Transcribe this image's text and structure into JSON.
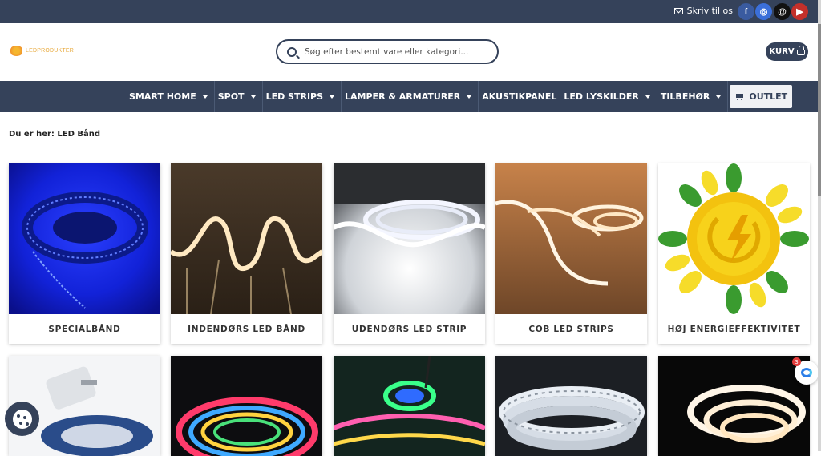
{
  "topbar": {
    "contact_label": "Skriv til os",
    "social": [
      {
        "icon": "facebook-icon",
        "glyph": "f"
      },
      {
        "icon": "instagram-icon",
        "glyph": "◎"
      },
      {
        "icon": "threads-icon",
        "glyph": "@"
      },
      {
        "icon": "youtube-icon",
        "glyph": "▶"
      }
    ]
  },
  "header": {
    "logo_text": "LEDPRODUKTER",
    "search_placeholder": "Søg efter bestemt vare eller kategori...",
    "cart_label": "KURV"
  },
  "nav": {
    "items": [
      {
        "label": "SMART HOME",
        "has_dropdown": true
      },
      {
        "label": "SPOT",
        "has_dropdown": true
      },
      {
        "label": "LED STRIPS",
        "has_dropdown": true
      },
      {
        "label": "LAMPER & ARMATURER",
        "has_dropdown": true
      },
      {
        "label": "AKUSTIKPANEL",
        "has_dropdown": false
      },
      {
        "label": "LED LYSKILDER",
        "has_dropdown": true
      },
      {
        "label": "TILBEHØR",
        "has_dropdown": true
      }
    ],
    "outlet_label": "OUTLET"
  },
  "breadcrumb": "Du er her: LED Bånd",
  "categories": [
    {
      "label": "SPECIALBÅND"
    },
    {
      "label": "INDENDØRS LED BÅND"
    },
    {
      "label": "UDENDØRS LED STRIP"
    },
    {
      "label": "COB LED STRIPS"
    },
    {
      "label": "HØJ ENERGIEFFEKTIVITET"
    }
  ],
  "chat_widget": {
    "badge_count": "3"
  },
  "colors": {
    "brand_navy": "#35425a",
    "logo_orange": "#e8a93b"
  }
}
